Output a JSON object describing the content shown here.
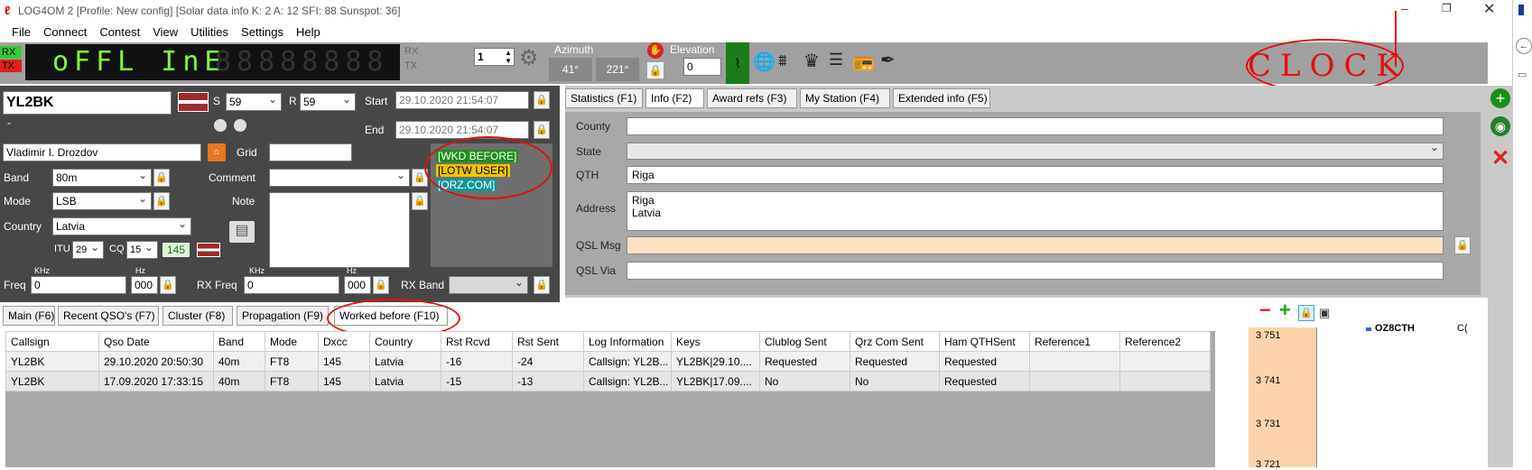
{
  "window": {
    "title": "LOG4OM 2 [Profile: New config] [Solar data info K: 2 A: 12 SFI: 88 Sunspot: 36]"
  },
  "menu": [
    "File",
    "Connect",
    "Contest",
    "View",
    "Utilities",
    "Settings",
    "Help"
  ],
  "toolbar": {
    "rx": "RX",
    "tx": "TX",
    "display": "oFFL InE",
    "rx2": "RX",
    "tx2": "TX",
    "radio_number": "1",
    "azimuth_label": "Azimuth",
    "azimuth_short": "41°",
    "azimuth_long": "221°",
    "elevation_label": "Elevation",
    "elevation_value": "0",
    "clock_annotation": "CLOCK"
  },
  "qso": {
    "callsign": "YL2BK",
    "s_label": "S",
    "s_value": "59",
    "r_label": "R",
    "r_value": "59",
    "start_label": "Start",
    "start_value": "29.10.2020 21:54:07",
    "end_label": "End",
    "end_value": "29.10.2020 21:54:07",
    "dash": "-",
    "name": "Vladimir I. Drozdov",
    "grid_label": "Grid",
    "grid_value": "",
    "band_label": "Band",
    "band_value": "80m",
    "comment_label": "Comment",
    "mode_label": "Mode",
    "mode_value": "LSB",
    "note_label": "Note",
    "country_label": "Country",
    "country_value": "Latvia",
    "itu_label": "ITU",
    "itu_value": "29",
    "cq_label": "CQ",
    "cq_value": "15",
    "dxcc": "145",
    "freq_label": "Freq",
    "khz": "KHz",
    "hz": "Hz",
    "freq_value": "0",
    "freq_hz": "000",
    "rxfreq_label": "RX Freq",
    "rxfreq_value": "0",
    "rxfreq_hz": "000",
    "rxband_label": "RX Band",
    "badges": [
      "[WKD BEFORE]",
      "[LOTW USER]",
      "[QRZ.COM]"
    ]
  },
  "info_tabs": [
    "Statistics (F1)",
    "Info (F2)",
    "Award refs (F3)",
    "My Station (F4)",
    "Extended info (F5)"
  ],
  "info": {
    "county_label": "County",
    "county": "",
    "state_label": "State",
    "qth_label": "QTH",
    "qth": "Riga",
    "address_label": "Address",
    "address_line1": "Riga",
    "address_line2": "Latvia",
    "qslmsg_label": "QSL Msg",
    "qslvia_label": "QSL Via"
  },
  "bottom_tabs": [
    "Main (F6)",
    "Recent QSO's (F7)",
    "Cluster (F8)",
    "Propagation (F9)",
    "Worked before (F10)"
  ],
  "table": {
    "headers": [
      "Callsign",
      "Qso Date",
      "Band",
      "Mode",
      "Dxcc",
      "Country",
      "Rst Rcvd",
      "Rst Sent",
      "Log Information",
      "Keys",
      "Clublog Sent",
      "Qrz Com Sent",
      "Ham QTHSent",
      "Reference1",
      "Reference2"
    ],
    "rows": [
      [
        "YL2BK",
        "29.10.2020 20:50:30",
        "40m",
        "FT8",
        "145",
        "Latvia",
        "-16",
        "-24",
        "Callsign: YL2B...",
        "YL2BK|29.10....",
        "Requested",
        "Requested",
        "Requested",
        "",
        ""
      ],
      [
        "YL2BK",
        "17.09.2020 17:33:15",
        "40m",
        "FT8",
        "145",
        "Latvia",
        "-15",
        "-13",
        "Callsign: YL2B...",
        "YL2BK|17.09....",
        "No",
        "No",
        "Requested",
        "",
        ""
      ]
    ]
  },
  "bandmap": {
    "ticks": [
      "3 751",
      "3 741",
      "3 731",
      "3 721"
    ],
    "spot": "OZ8CTH",
    "spot2": "C("
  }
}
